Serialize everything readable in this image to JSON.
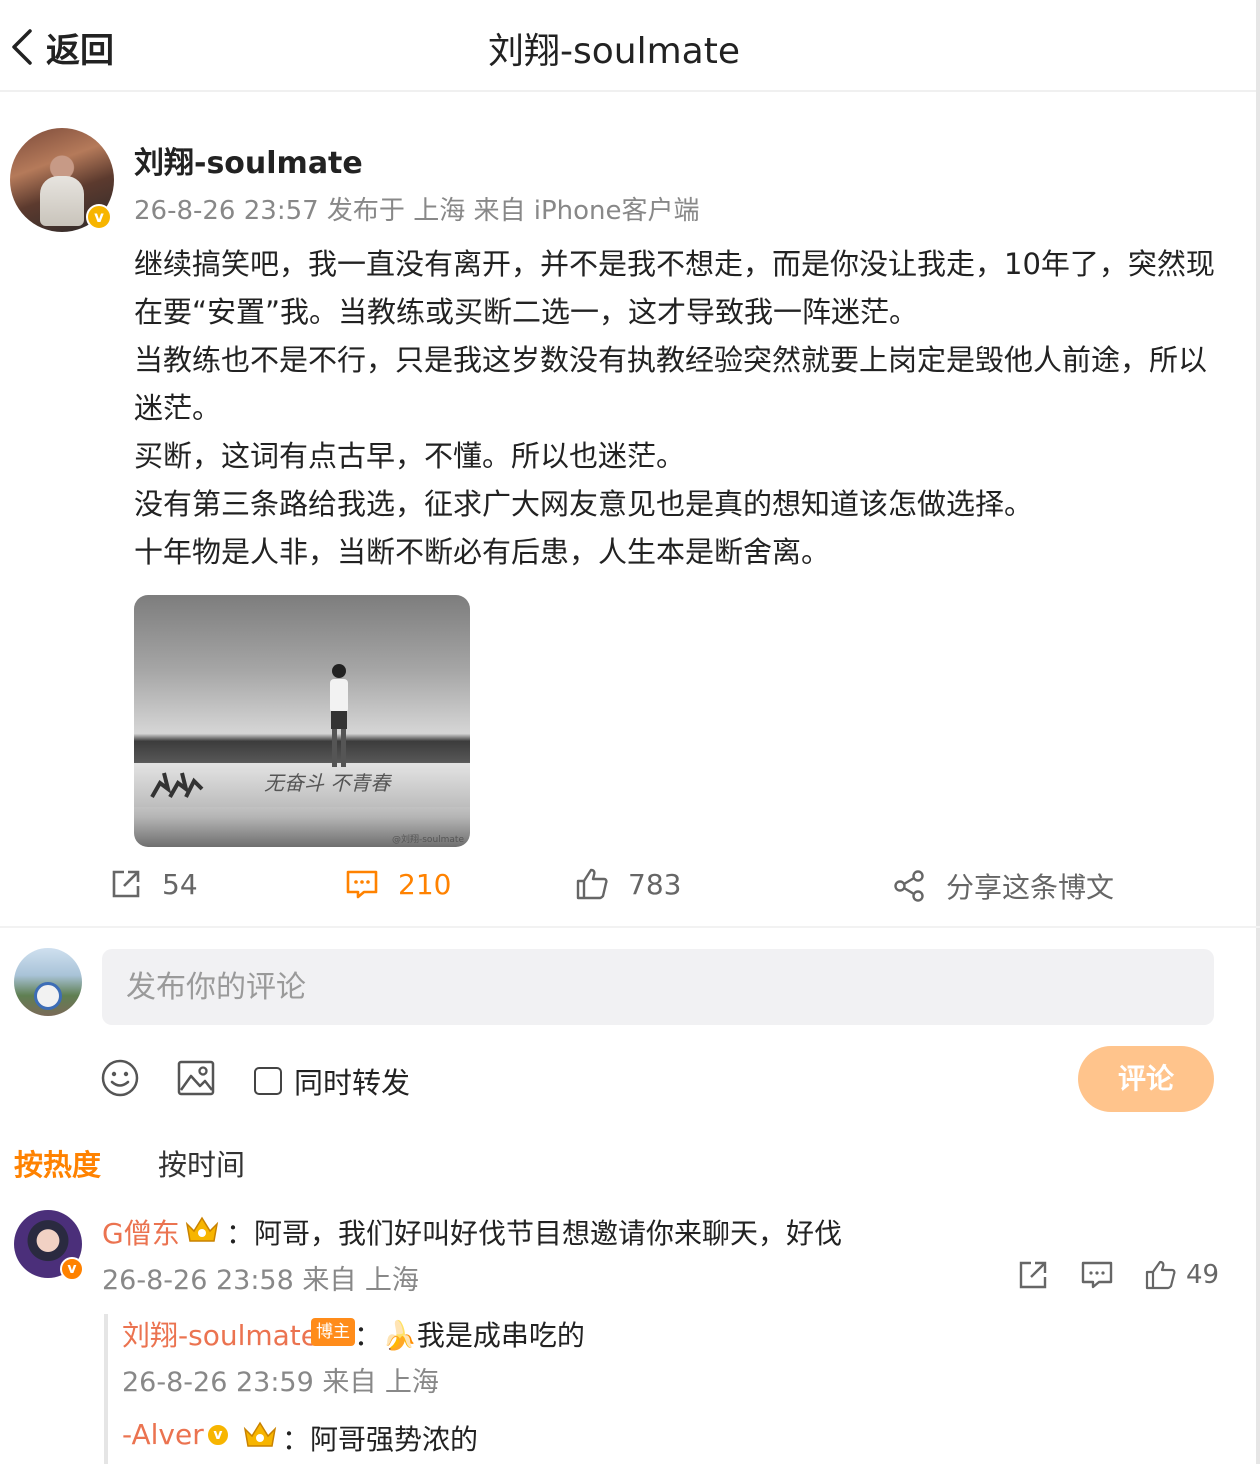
{
  "header": {
    "back_label": "返回",
    "title": "刘翔-soulmate"
  },
  "post": {
    "author": "刘翔-soulmate",
    "meta": "26-8-26 23:57  发布于 上海  来自 iPhone客户端",
    "paragraphs": [
      "继续搞笑吧，我一直没有离开，并不是我不想走，而是你没让我走，10年了，突然现在要“安置”我。当教练或买断二选一，这才导致我一阵迷茫。",
      "当教练也不是不行，只是我这岁数没有执教经验突然就要上岗定是毁他人前途，所以迷茫。",
      "买断，这词有点古早，不懂。所以也迷茫。",
      "没有第三条路给我选，征求广大网友意见也是真的想知道该怎做选择。",
      "十年物是人非，当断不断必有后患，人生本是断舍离。"
    ],
    "image_painted_text": "无奋斗 不青春",
    "image_watermark": "@刘翔-soulmate",
    "repost_count": "54",
    "comment_count": "210",
    "like_count": "783",
    "share_label": "分享这条博文"
  },
  "composer": {
    "placeholder": "发布你的评论",
    "repost_label": "同时转发",
    "submit_label": "评论"
  },
  "sort": {
    "hot": "按热度",
    "time": "按时间"
  },
  "comments": [
    {
      "name": "G僧东",
      "text": "：阿哥，我们好叫好伐节目想邀请你来聊天，好伐",
      "meta": "26-8-26 23:58  来自 上海",
      "likes": "49",
      "replies": [
        {
          "name": "刘翔-soulmate",
          "tag": "博主",
          "text": "：🍌我是成串吃的",
          "meta": "26-8-26 23:59  来自 上海"
        },
        {
          "name": "-Alver",
          "text": "：阿哥强势浓的"
        }
      ]
    }
  ],
  "colors": {
    "accent": "#ff8200",
    "username": "#eb7350",
    "submit_disabled": "#ffc48c",
    "verified": "#f7b500"
  }
}
